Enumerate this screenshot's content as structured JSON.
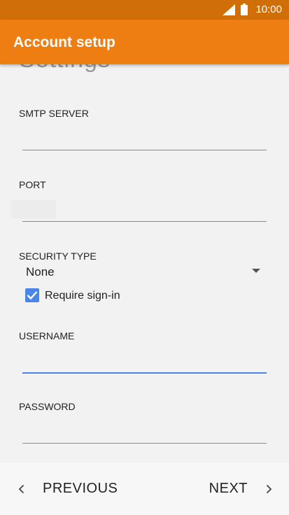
{
  "status_bar": {
    "time": "10:00"
  },
  "app_bar": {
    "title": "Account setup"
  },
  "form": {
    "heading": "Settings",
    "smtp_server": {
      "label": "SMTP SERVER",
      "value": ""
    },
    "port": {
      "label": "PORT",
      "value": ""
    },
    "security_type": {
      "label": "SECURITY TYPE",
      "value": "None"
    },
    "require_signin": {
      "label": "Require sign-in",
      "checked": true
    },
    "username": {
      "label": "USERNAME",
      "value": ""
    },
    "password": {
      "label": "PASSWORD",
      "value": ""
    }
  },
  "bottom_nav": {
    "previous_label": "PREVIOUS",
    "next_label": "NEXT"
  },
  "colors": {
    "status_bar": "#d06e08",
    "app_bar": "#ee7d12",
    "accent": "#4a86e8"
  },
  "icons": [
    "signal-icon",
    "battery-icon",
    "caret-down-icon",
    "check-icon",
    "chevron-left-icon",
    "chevron-right-icon"
  ]
}
